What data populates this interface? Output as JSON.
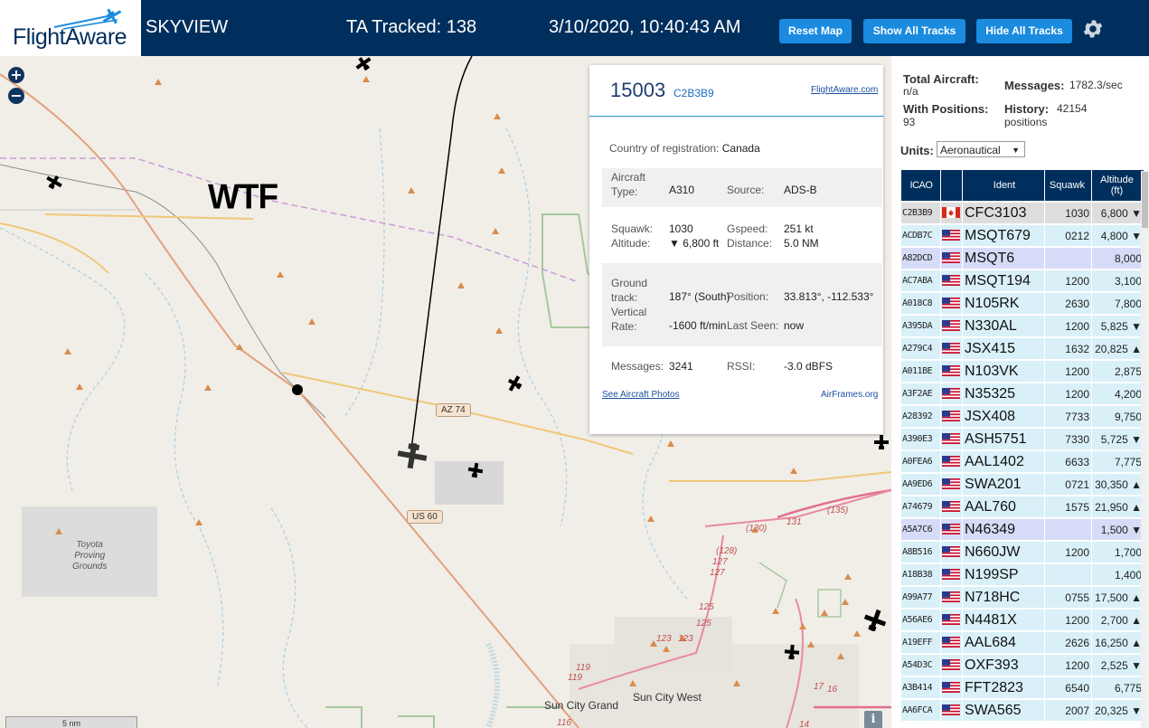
{
  "header": {
    "logo_text": "FlightAware",
    "app_title": "SKYVIEW",
    "tracked_text": "TA Tracked: 138",
    "datetime": "3/10/2020, 10:40:43 AM",
    "buttons": {
      "reset": "Reset Map",
      "show": "Show All Tracks",
      "hide": "Hide All Tracks"
    },
    "settings_icon": "gear-icon",
    "colors": {
      "bar": "#002f5d",
      "button": "#1b8be0"
    }
  },
  "map": {
    "zoom_in": "+",
    "zoom_out": "−",
    "overlay_text": "WTF",
    "labels": {
      "toyota": "Toyota\nProving\nGrounds",
      "sun_city_grand": "Sun City Grand",
      "sun_city_west": "Sun City West"
    },
    "shields": {
      "az74": "AZ 74",
      "us60": "US 60"
    },
    "route_numbers": [
      "(130)",
      "131",
      "(135)",
      "(128)",
      "127",
      "127",
      "125",
      "125",
      "123",
      "123",
      "119",
      "119",
      "116",
      "17",
      "16",
      "14"
    ],
    "scale": "5 nm",
    "info": "i"
  },
  "popup": {
    "registration": "15003",
    "hex": "C2B3B9",
    "flightaware_link": "FlightAware.com",
    "country_label": "Country of registration:",
    "country": "Canada",
    "aircraft_type_label": "Aircraft Type:",
    "aircraft_type": "A310",
    "source_label": "Source:",
    "source": "ADS-B",
    "squawk_label": "Squawk:",
    "squawk": "1030",
    "gspeed_label": "Gspeed:",
    "gspeed": "251 kt",
    "altitude_label": "Altitude:",
    "altitude": "▼ 6,800 ft",
    "distance_label": "Distance:",
    "distance": "5.0 NM",
    "ground_track_label": "Ground track:",
    "ground_track": "187° (South)",
    "position_label": "Position:",
    "position": "33.813°, -112.533°",
    "vrate_label": "Vertical Rate:",
    "vrate": "-1600 ft/min",
    "last_seen_label": "Last Seen:",
    "last_seen": "now",
    "messages_label": "Messages:",
    "messages": "3241",
    "rssi_label": "RSSI:",
    "rssi": "-3.0 dBFS",
    "photos_link": "See Aircraft Photos",
    "airframes_link": "AirFrames.org"
  },
  "stats": {
    "total_label": "Total Aircraft:",
    "total": "n/a",
    "positions_label": "With Positions:",
    "positions": "93",
    "messages_label": "Messages:",
    "messages": "1782.3/sec",
    "history_label": "History:",
    "history": "42154",
    "history_unit": "positions",
    "units_label": "Units:",
    "units": "Aeronautical"
  },
  "table": {
    "headers": {
      "icao": "ICAO",
      "ident": "Ident",
      "squawk": "Squawk",
      "altitude": "Altitude",
      "altitude_unit": "(ft)"
    },
    "rows": [
      {
        "icao": "C2B3B9",
        "flag": "ca",
        "ident": "CFC3103",
        "squawk": "1030",
        "alt": "6,800 ▼",
        "style": "sel"
      },
      {
        "icao": "ACDB7C",
        "flag": "us",
        "ident": "MSQT679",
        "squawk": "0212",
        "alt": "4,800 ▼",
        "style": ""
      },
      {
        "icao": "A82DCD",
        "flag": "us",
        "ident": "MSQT6",
        "squawk": "",
        "alt": "8,000",
        "style": "mlat"
      },
      {
        "icao": "AC7ABA",
        "flag": "us",
        "ident": "MSQT194",
        "squawk": "1200",
        "alt": "3,100",
        "style": ""
      },
      {
        "icao": "A018C8",
        "flag": "us",
        "ident": "N105RK",
        "squawk": "2630",
        "alt": "7,800",
        "style": ""
      },
      {
        "icao": "A395DA",
        "flag": "us",
        "ident": "N330AL",
        "squawk": "1200",
        "alt": "5,825 ▼",
        "style": ""
      },
      {
        "icao": "A279C4",
        "flag": "us",
        "ident": "JSX415",
        "squawk": "1632",
        "alt": "20,825 ▲",
        "style": ""
      },
      {
        "icao": "A011BE",
        "flag": "us",
        "ident": "N103VK",
        "squawk": "1200",
        "alt": "2,875",
        "style": ""
      },
      {
        "icao": "A3F2AE",
        "flag": "us",
        "ident": "N35325",
        "squawk": "1200",
        "alt": "4,200",
        "style": ""
      },
      {
        "icao": "A28392",
        "flag": "us",
        "ident": "JSX408",
        "squawk": "7733",
        "alt": "9,750",
        "style": ""
      },
      {
        "icao": "A390E3",
        "flag": "us",
        "ident": "ASH5751",
        "squawk": "7330",
        "alt": "5,725 ▼",
        "style": ""
      },
      {
        "icao": "A0FEA6",
        "flag": "us",
        "ident": "AAL1402",
        "squawk": "6633",
        "alt": "7,775",
        "style": ""
      },
      {
        "icao": "AA9ED6",
        "flag": "us",
        "ident": "SWA201",
        "squawk": "0721",
        "alt": "30,350 ▲",
        "style": ""
      },
      {
        "icao": "A74679",
        "flag": "us",
        "ident": "AAL760",
        "squawk": "1575",
        "alt": "21,950 ▲",
        "style": ""
      },
      {
        "icao": "A5A7C6",
        "flag": "us",
        "ident": "N46349",
        "squawk": "",
        "alt": "1,500 ▼",
        "style": "mlat"
      },
      {
        "icao": "A8B516",
        "flag": "us",
        "ident": "N660JW",
        "squawk": "1200",
        "alt": "1,700",
        "style": ""
      },
      {
        "icao": "A18B38",
        "flag": "us",
        "ident": "N199SP",
        "squawk": "",
        "alt": "1,400",
        "style": ""
      },
      {
        "icao": "A99A77",
        "flag": "us",
        "ident": "N718HC",
        "squawk": "0755",
        "alt": "17,500 ▲",
        "style": ""
      },
      {
        "icao": "A56AE6",
        "flag": "us",
        "ident": "N4481X",
        "squawk": "1200",
        "alt": "2,700 ▲",
        "style": ""
      },
      {
        "icao": "A19EFF",
        "flag": "us",
        "ident": "AAL684",
        "squawk": "2626",
        "alt": "16,250 ▲",
        "style": ""
      },
      {
        "icao": "A54D3C",
        "flag": "us",
        "ident": "OXF393",
        "squawk": "1200",
        "alt": "2,525 ▼",
        "style": ""
      },
      {
        "icao": "A3B414",
        "flag": "us",
        "ident": "FFT2823",
        "squawk": "6540",
        "alt": "6,775",
        "style": ""
      },
      {
        "icao": "AA6FCA",
        "flag": "us",
        "ident": "SWA565",
        "squawk": "2007",
        "alt": "20,325 ▼",
        "style": ""
      }
    ]
  }
}
